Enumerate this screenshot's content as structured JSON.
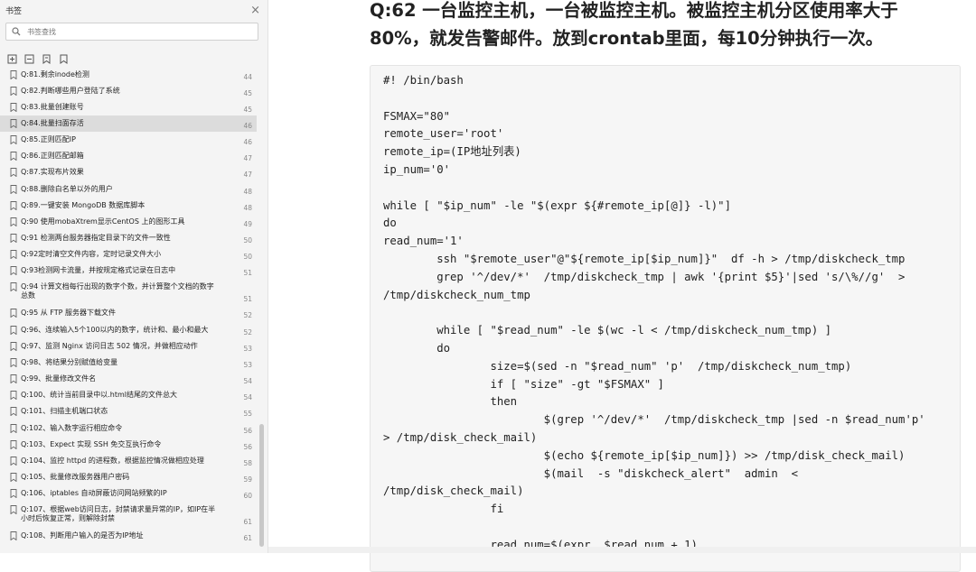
{
  "sidebar": {
    "title": "书签",
    "close_glyph": "×",
    "search_placeholder": "书签查找",
    "tool_icons": [
      "expand-all-icon",
      "collapse-all-icon",
      "add-bookmark-icon",
      "bookmark-icon"
    ],
    "items": [
      {
        "title": "Q:81.剩余inode检测",
        "page": "44"
      },
      {
        "title": "Q:82.判断哪些用户登陆了系统",
        "page": "45"
      },
      {
        "title": "Q:83.批量创建账号",
        "page": "45"
      },
      {
        "title": "Q:84.批量扫面存活",
        "page": "46"
      },
      {
        "title": "Q:85.正则匹配IP",
        "page": "46"
      },
      {
        "title": "Q:86.正则匹配邮箱",
        "page": "47"
      },
      {
        "title": "Q:87.实现布片效果",
        "page": "47"
      },
      {
        "title": "Q:88.删除白名单以外的用户",
        "page": "48"
      },
      {
        "title": "Q:89.一键安装 MongoDB 数据库脚本",
        "page": "48"
      },
      {
        "title": "Q:90 使用mobaXtrem显示CentOS 上的图形工具",
        "page": "49"
      },
      {
        "title": "Q:91 检测两台服务器指定目录下的文件一致性",
        "page": "50"
      },
      {
        "title": "Q:92定时清空文件内容，定时记录文件大小",
        "page": "50"
      },
      {
        "title": "Q:93检测网卡流量，并按规定格式记录在日志中",
        "page": "51"
      },
      {
        "title": "Q:94 计算文档每行出现的数字个数，并计算整个文档的数字总数",
        "page": "51"
      },
      {
        "title": "Q:95 从 FTP 服务器下载文件",
        "page": "52"
      },
      {
        "title": "Q:96、连续输入5个100以内的数字，统计和、最小和最大",
        "page": "52"
      },
      {
        "title": "Q:97、监测 Nginx 访问日志 502 情况，并做相应动作",
        "page": "53"
      },
      {
        "title": "Q:98、将结果分别赋值给变量",
        "page": "53"
      },
      {
        "title": "Q:99、批量修改文件名",
        "page": "54"
      },
      {
        "title": "Q:100、统计当前目录中以.html结尾的文件总大",
        "page": "54"
      },
      {
        "title": "Q:101、扫描主机端口状态",
        "page": "55"
      },
      {
        "title": "Q:102、输入数字运行相应命令",
        "page": "56"
      },
      {
        "title": "Q:103、Expect 实现 SSH 免交互执行命令",
        "page": "56"
      },
      {
        "title": "Q:104、监控 httpd 的进程数，根据监控情况做相应处理",
        "page": "58"
      },
      {
        "title": "Q:105、批量修改服务器用户密码",
        "page": "59"
      },
      {
        "title": "Q:106、iptables 自动屏蔽访问网站频繁的IP",
        "page": "60"
      },
      {
        "title": "Q:107、根据web访问日志，封禁请求量异常的IP，如IP在半小时后恢复正常，则解除封禁",
        "page": "61"
      },
      {
        "title": "Q:108、判断用户输入的是否为IP地址",
        "page": "61"
      }
    ]
  },
  "content": {
    "title": "Q:62 一台监控主机，一台被监控主机。被监控主机分区使用率大于80%，就发告警邮件。放到crontab里面，每10分钟执行一次。",
    "code": "#! /bin/bash\n\nFSMAX=\"80\"\nremote_user='root'\nremote_ip=(IP地址列表)\nip_num='0'\n\nwhile [ \"$ip_num\" -le \"$(expr ${#remote_ip[@]} -l)\"]\ndo\nread_num='1'\n        ssh \"$remote_user\"@\"${remote_ip[$ip_num]}\"  df -h > /tmp/diskcheck_tmp\n        grep '^/dev/*'  /tmp/diskcheck_tmp | awk '{print $5}'|sed 's/\\%//g'  >\n/tmp/diskcheck_num_tmp\n\n        while [ \"$read_num\" -le $(wc -l < /tmp/diskcheck_num_tmp) ]\n        do\n                size=$(sed -n \"$read_num\" 'p'  /tmp/diskcheck_num_tmp)\n                if [ \"size\" -gt \"$FSMAX\" ]\n                then\n                        $(grep '^/dev/*'  /tmp/diskcheck_tmp |sed -n $read_num'p'\n> /tmp/disk_check_mail)\n                        $(echo ${remote_ip[$ip_num]}) >> /tmp/disk_check_mail)\n                        $(mail  -s \"diskcheck_alert\"  admin  <\n/tmp/disk_check_mail)\n                fi\n\n                read_num=$(expr  $read_num + 1)"
  },
  "colors": {
    "active_item": "#dcdcdc",
    "sidebar_bg": "#f4f4f4",
    "code_bg": "#f6f6f6"
  }
}
